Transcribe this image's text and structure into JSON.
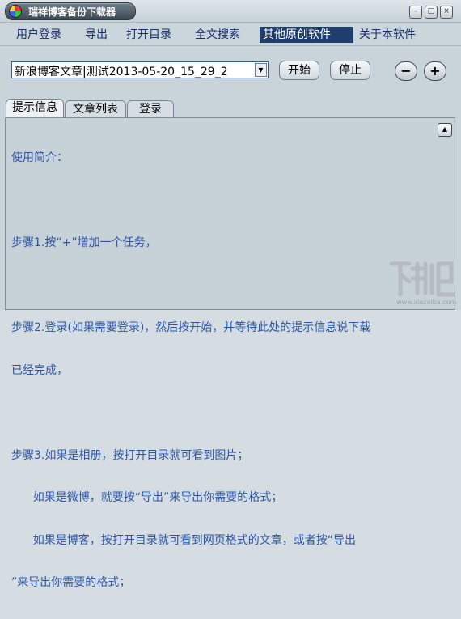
{
  "window": {
    "title": "瑞祥博客备份下载器",
    "controls": {
      "minimize": "–",
      "maximize": "□",
      "close": "×"
    }
  },
  "menu": {
    "items": [
      "用户登录",
      "导出",
      "打开目录",
      "全文搜索",
      "其他原创软件",
      "关于本软件"
    ],
    "active_index": 4
  },
  "toolbar": {
    "combo_value": "新浪博客文章|测试2013-05-20_15_29_2",
    "start_label": "开始",
    "stop_label": "停止",
    "minus_label": "−",
    "plus_label": "+"
  },
  "tabs": {
    "items": [
      "提示信息",
      "文章列表",
      "登录"
    ],
    "active_index": 0
  },
  "content": {
    "lines": [
      "使用简介：",
      "",
      "步骤1.按“+”增加一个任务，",
      "",
      "步骤2.登录(如果需要登录)，然后按开始，并等待此处的提示信息说下载",
      "已经完成，",
      "",
      "步骤3.如果是相册，按打开目录就可看到图片；",
      "      如果是微博，就要按“导出”来导出你需要的格式；",
      "      如果是博客，按打开目录就可看到网页格式的文章，或者按“导出",
      "”来导出你需要的格式；"
    ]
  },
  "watermark": {
    "text": "下载吧",
    "url": "www.xiazaiba.com"
  },
  "colors": {
    "title_bg": "#3a4852",
    "menu_active": "#1e3e6e",
    "content_text": "#2b56a6"
  }
}
